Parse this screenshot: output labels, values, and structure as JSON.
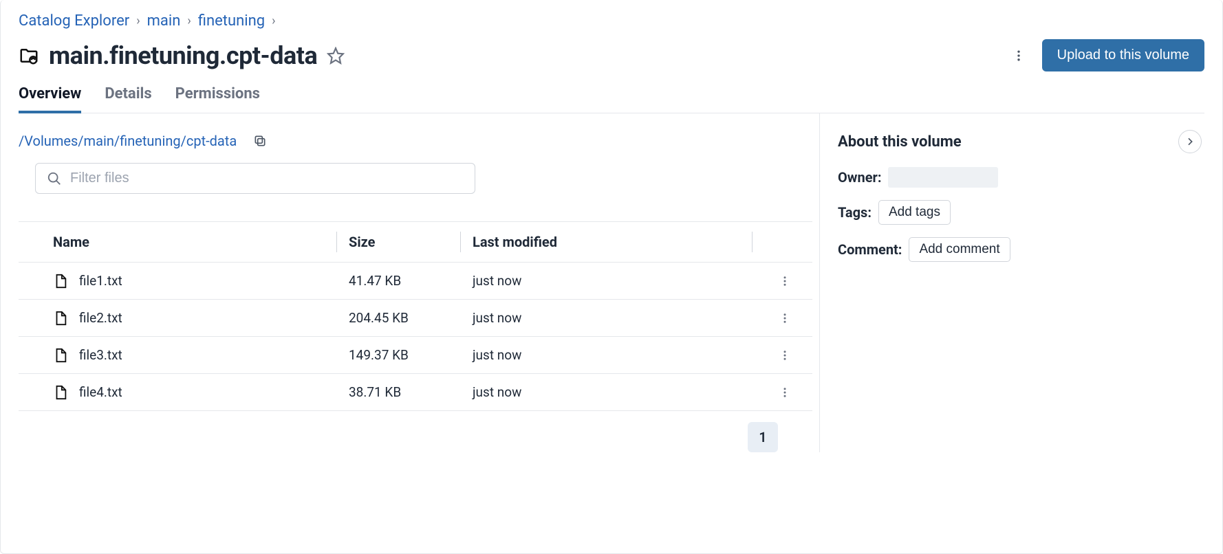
{
  "breadcrumb": {
    "root": "Catalog Explorer",
    "catalog": "main",
    "schema": "finetuning"
  },
  "title": "main.finetuning.cpt-data",
  "upload_button": "Upload to this volume",
  "tabs": {
    "overview": "Overview",
    "details": "Details",
    "permissions": "Permissions"
  },
  "path": "/Volumes/main/finetuning/cpt-data",
  "filter_placeholder": "Filter files",
  "table": {
    "headers": {
      "name": "Name",
      "size": "Size",
      "modified": "Last modified"
    },
    "rows": [
      {
        "name": "file1.txt",
        "size": "41.47 KB",
        "modified": "just now"
      },
      {
        "name": "file2.txt",
        "size": "204.45 KB",
        "modified": "just now"
      },
      {
        "name": "file3.txt",
        "size": "149.37 KB",
        "modified": "just now"
      },
      {
        "name": "file4.txt",
        "size": "38.71 KB",
        "modified": "just now"
      }
    ]
  },
  "pagination": {
    "current": "1"
  },
  "about": {
    "heading": "About this volume",
    "owner_label": "Owner:",
    "tags_label": "Tags:",
    "tags_button": "Add tags",
    "comment_label": "Comment:",
    "comment_button": "Add comment"
  }
}
